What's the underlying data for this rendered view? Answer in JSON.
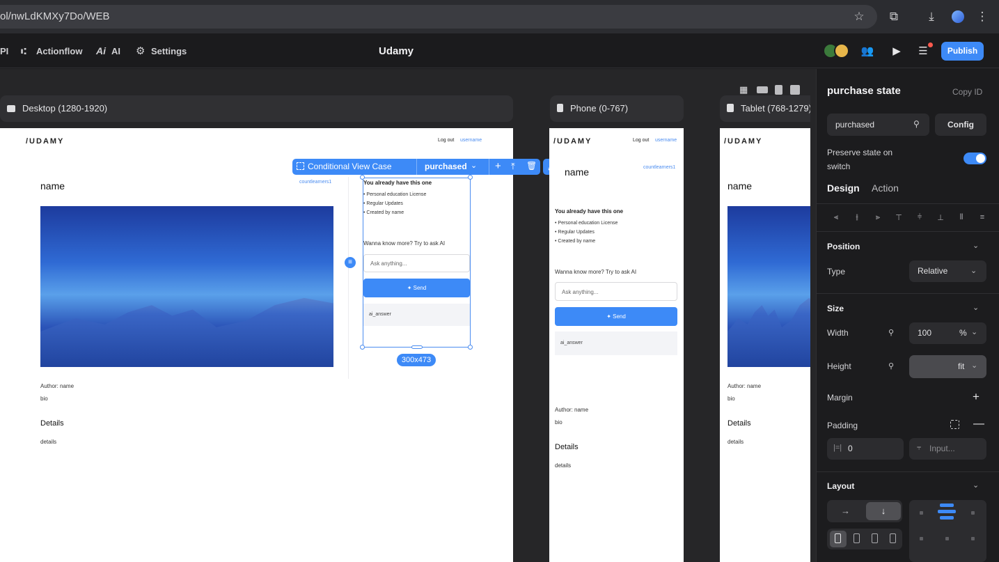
{
  "browser": {
    "url": "ol/nwLdKMXy7Do/WEB",
    "icons": [
      "star-icon",
      "extensions-icon",
      "download-icon",
      "profile-icon",
      "kebab-menu-icon"
    ]
  },
  "toolbar": {
    "partial_item": "PI",
    "actionflow": "Actionflow",
    "ai": "AI",
    "settings": "Settings",
    "app_name": "Udamy",
    "publish": "Publish"
  },
  "devices": {
    "desktop": "Desktop (1280-1920)",
    "phone": "Phone (0-767)",
    "tablet": "Tablet (768-1279)"
  },
  "page": {
    "logo": "/UDAMY",
    "logout": "Log out",
    "username": "username",
    "name": "name",
    "count_learners": "countlearners1",
    "already_have": "You already have this one",
    "bullets": [
      "• Personal education License",
      "• Regular Updates",
      "• Created by name"
    ],
    "wanna_know": "Wanna know more?  Try to ask AI",
    "ask_placeholder": "Ask anything...",
    "send": "Send",
    "ai_answer": "ai_answer",
    "author": "Author: name",
    "bio": "bio",
    "details_heading": "Details",
    "details": "details"
  },
  "selection": {
    "label": "Conditional View Case",
    "value": "purchased",
    "size": "300x473"
  },
  "panel": {
    "title": "purchase state",
    "copy_id": "Copy ID",
    "state_value": "purchased",
    "config": "Config",
    "preserve": "Preserve state on switch",
    "preserve_on": true,
    "tabs": [
      "Design",
      "Action"
    ],
    "position_heading": "Position",
    "type_label": "Type",
    "type_value": "Relative",
    "size_heading": "Size",
    "width_label": "Width",
    "width_value": "100",
    "width_unit": "%",
    "height_label": "Height",
    "height_value": "fit",
    "margin_label": "Margin",
    "padding_label": "Padding",
    "padding_left": "0",
    "padding_input_placeholder": "Input...",
    "layout_heading": "Layout"
  },
  "colors": {
    "accent": "#3d8af7",
    "panel_bg": "#1c1c1e",
    "canvas_bg": "#262628"
  }
}
